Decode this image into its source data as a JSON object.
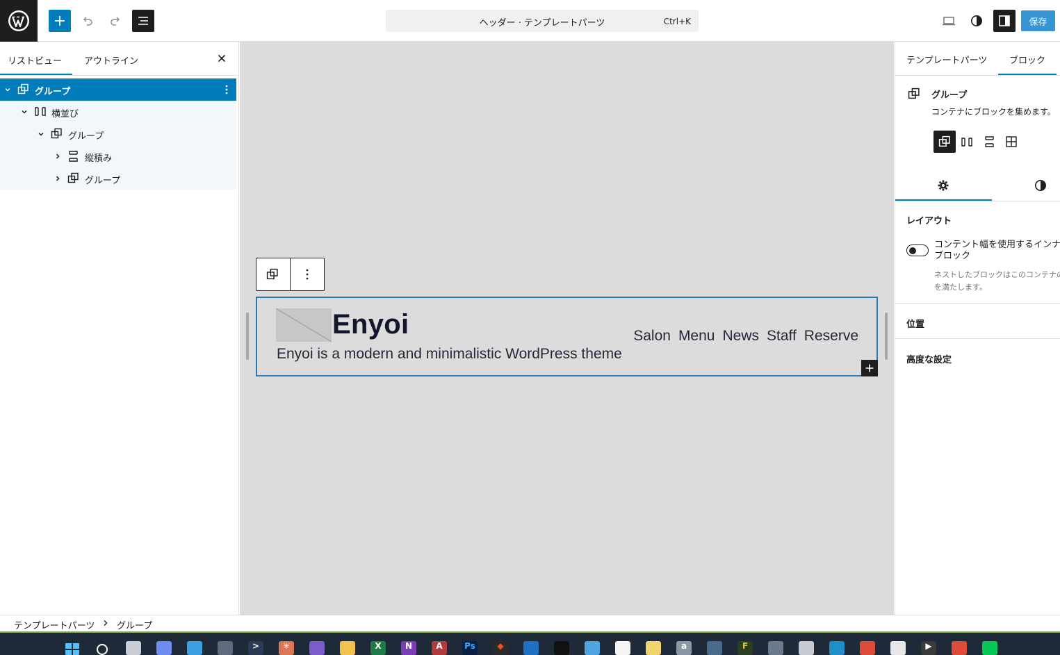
{
  "toolbar": {
    "document_title": "ヘッダー · テンプレートパーツ",
    "shortcut": "Ctrl+K",
    "save_label": "保存",
    "icons": [
      "wordpress-icon",
      "plus-icon",
      "undo-icon",
      "redo-icon",
      "list-view-icon",
      "desktop-icon",
      "contrast-icon",
      "sidebar-icon"
    ]
  },
  "left_panel": {
    "tabs": [
      {
        "label": "リストビュー",
        "active": true
      },
      {
        "label": "アウトライン",
        "active": false
      }
    ],
    "tree": [
      {
        "label": "グループ",
        "depth": 0,
        "expanded": true,
        "selected": true,
        "icon": "group-icon"
      },
      {
        "label": "横並び",
        "depth": 1,
        "expanded": true,
        "selected": false,
        "icon": "row-icon"
      },
      {
        "label": "グループ",
        "depth": 2,
        "expanded": true,
        "selected": false,
        "icon": "group-icon"
      },
      {
        "label": "縦積み",
        "depth": 3,
        "expanded": false,
        "selected": false,
        "icon": "stack-icon"
      },
      {
        "label": "グループ",
        "depth": 3,
        "expanded": false,
        "selected": false,
        "icon": "group-icon"
      }
    ]
  },
  "canvas": {
    "site_title": "Enyoi",
    "tagline": "Enyoi is a modern and minimalistic WordPress theme",
    "nav": [
      "Salon",
      "Menu",
      "News",
      "Staff",
      "Reserve"
    ]
  },
  "right_panel": {
    "tabs": [
      {
        "label": "テンプレートパーツ",
        "active": false
      },
      {
        "label": "ブロック",
        "active": true
      }
    ],
    "block": {
      "title": "グループ",
      "description": "コンテナにブロックを集めます。"
    },
    "variations": [
      "group-icon",
      "row-icon",
      "stack-icon",
      "grid-icon"
    ],
    "layout_heading": "レイアウト",
    "toggle_label": "コンテント幅を使用するインナーブロック",
    "toggle_on": false,
    "toggle_help": "ネストしたブロックはこのコンテナの幅を満たします。",
    "sections": [
      "位置",
      "高度な設定"
    ]
  },
  "breadcrumb": [
    "テンプレートパーツ",
    "グループ"
  ],
  "taskbar_apps": [
    "start",
    "search",
    "task-view",
    "copilot",
    "photos",
    "remote",
    "terminal",
    "claude",
    "obsidian",
    "explorer",
    "excel",
    "onenote",
    "access",
    "photoshop",
    "figma",
    "vscode",
    "app",
    "notepad",
    "notebook",
    "notes",
    "dict",
    "globe",
    "ftp",
    "lock",
    "github",
    "edge",
    "chrome",
    "slack",
    "player",
    "chrome-2",
    "line"
  ]
}
